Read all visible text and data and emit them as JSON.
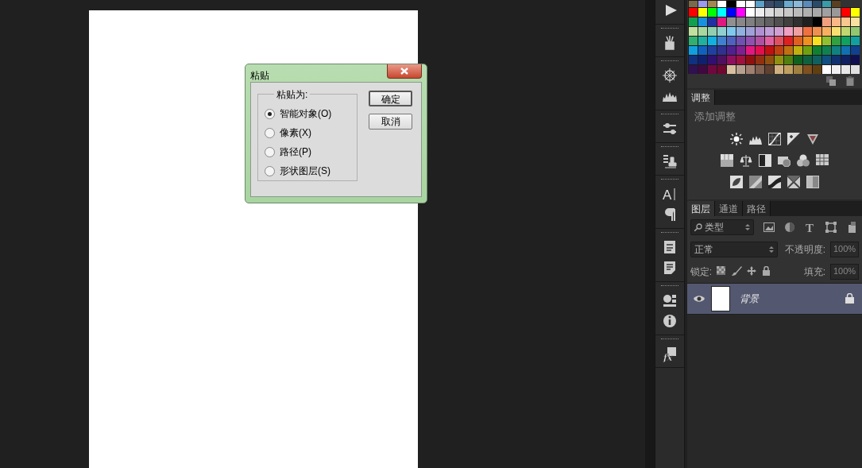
{
  "paste_dialog": {
    "title": "粘贴",
    "group_label": "粘贴为:",
    "options": [
      {
        "label": "智能对象(O)",
        "selected": true
      },
      {
        "label": "像素(X)",
        "selected": false
      },
      {
        "label": "路径(P)",
        "selected": false
      },
      {
        "label": "形状图层(S)",
        "selected": false
      }
    ],
    "buttons": [
      {
        "label": "确定",
        "default": true
      },
      {
        "label": "取消",
        "default": false
      }
    ]
  },
  "swatches": {
    "rows": [
      {
        "cells": [
          {
            "color": "#7a6a4a"
          },
          {
            "color": "#9a9aee"
          },
          {
            "color": "#a08850"
          },
          {
            "color": "#ffffff"
          },
          {
            "color": "#000000"
          },
          {
            "color": "#ffffff"
          },
          {
            "color": "#ffffff"
          },
          {
            "color": "#5aa0c8"
          },
          {
            "color": "#3a4a6a"
          },
          {
            "color": "#2a4a6a"
          },
          {
            "color": "#6aaad0"
          },
          {
            "color": "#8ab8d8"
          },
          {
            "color": "#5a8ab8"
          },
          {
            "color": "#2a4a6a"
          },
          {
            "color": "#3a9aa8"
          },
          {
            "color": "#5a4020"
          }
        ]
      },
      {
        "cells": [
          {
            "color": "#ff0000"
          },
          {
            "color": "#ffff00"
          },
          {
            "color": "#00ff00"
          },
          {
            "color": "#00ffff"
          },
          {
            "color": "#0000ff"
          },
          {
            "color": "#ff00ff"
          },
          {
            "color": "#ffffff"
          },
          {
            "color": "#eeeeee"
          },
          {
            "color": "#dddddd"
          },
          {
            "color": "#d0d0d0"
          },
          {
            "color": "#c8c8c8"
          },
          {
            "color": "#bbbbbb"
          },
          {
            "color": "#b0b0b0"
          },
          {
            "color": "#a8a8a8"
          },
          {
            "color": "#a0a0a0"
          },
          {
            "color": "#999999"
          },
          {
            "color": "#ff0000"
          },
          {
            "color": "#ffff00"
          }
        ]
      },
      {
        "cells": [
          {
            "color": "#10a050"
          },
          {
            "color": "#1890e0"
          },
          {
            "color": "#2030a0"
          },
          {
            "color": "#e01880"
          },
          {
            "color": "#909090"
          },
          {
            "color": "#888888"
          },
          {
            "color": "#808080"
          },
          {
            "color": "#707070"
          },
          {
            "color": "#606060"
          },
          {
            "color": "#505050"
          },
          {
            "color": "#404040"
          },
          {
            "color": "#303030"
          },
          {
            "color": "#202020"
          },
          {
            "color": "#000000"
          },
          {
            "color": "#f0a080"
          },
          {
            "color": "#f8b888"
          },
          {
            "color": "#f8c890"
          },
          {
            "color": "#f8e0a0"
          }
        ]
      },
      {
        "cells": [
          {
            "color": "#c0e0a0"
          },
          {
            "color": "#a8d8a0"
          },
          {
            "color": "#90d0b0"
          },
          {
            "color": "#90d0d0"
          },
          {
            "color": "#80c8f0"
          },
          {
            "color": "#90b0e0"
          },
          {
            "color": "#a0a0d8"
          },
          {
            "color": "#b090d0"
          },
          {
            "color": "#c0a0d8"
          },
          {
            "color": "#d0a0d0"
          },
          {
            "color": "#f0a0c0"
          },
          {
            "color": "#f0a0a0"
          },
          {
            "color": "#f07040"
          },
          {
            "color": "#f09050"
          },
          {
            "color": "#f8b060"
          },
          {
            "color": "#f8e070"
          },
          {
            "color": "#c0d870"
          },
          {
            "color": "#90c870"
          }
        ]
      },
      {
        "cells": [
          {
            "color": "#30b070"
          },
          {
            "color": "#20b0a0"
          },
          {
            "color": "#10b0e0"
          },
          {
            "color": "#4080d0"
          },
          {
            "color": "#5060c0"
          },
          {
            "color": "#7050b0"
          },
          {
            "color": "#9050b0"
          },
          {
            "color": "#b050a0"
          },
          {
            "color": "#e060a0"
          },
          {
            "color": "#e05060"
          },
          {
            "color": "#e02020"
          },
          {
            "color": "#e06020"
          },
          {
            "color": "#f09020"
          },
          {
            "color": "#f8e020"
          },
          {
            "color": "#90c030"
          },
          {
            "color": "#30a040"
          },
          {
            "color": "#10a060"
          },
          {
            "color": "#10a0a0"
          }
        ]
      },
      {
        "cells": [
          {
            "color": "#10a0e0"
          },
          {
            "color": "#1060c0"
          },
          {
            "color": "#2040a0"
          },
          {
            "color": "#303090"
          },
          {
            "color": "#502090"
          },
          {
            "color": "#802090"
          },
          {
            "color": "#e01880"
          },
          {
            "color": "#e01050"
          },
          {
            "color": "#c01010"
          },
          {
            "color": "#c04010"
          },
          {
            "color": "#c07010"
          },
          {
            "color": "#c0b010"
          },
          {
            "color": "#70a010"
          },
          {
            "color": "#108030"
          },
          {
            "color": "#108050"
          },
          {
            "color": "#108080"
          },
          {
            "color": "#1070b0"
          },
          {
            "color": "#104090"
          }
        ]
      },
      {
        "cells": [
          {
            "color": "#103080"
          },
          {
            "color": "#102070"
          },
          {
            "color": "#301070"
          },
          {
            "color": "#501060"
          },
          {
            "color": "#901060"
          },
          {
            "color": "#a01040"
          },
          {
            "color": "#901010"
          },
          {
            "color": "#903010"
          },
          {
            "color": "#905010"
          },
          {
            "color": "#909010"
          },
          {
            "color": "#508010"
          },
          {
            "color": "#106020"
          },
          {
            "color": "#106040"
          },
          {
            "color": "#106060"
          },
          {
            "color": "#105080"
          },
          {
            "color": "#103070"
          },
          {
            "color": "#102060"
          },
          {
            "color": "#101050"
          }
        ]
      },
      {
        "cells": [
          {
            "color": "#301050"
          },
          {
            "color": "#400840"
          },
          {
            "color": "#700840"
          },
          {
            "color": "#700830"
          },
          {
            "color": "#d8c0a0"
          },
          {
            "color": "#b8a090"
          },
          {
            "color": "#a08070"
          },
          {
            "color": "#806050"
          },
          {
            "color": "#604030"
          },
          {
            "color": "#d0b080"
          },
          {
            "color": "#c0a060"
          },
          {
            "color": "#a08040"
          },
          {
            "color": "#805020"
          },
          {
            "color": "#604010"
          },
          {
            "color": "#ffffff"
          },
          {
            "color": "#f0f0f0"
          },
          {
            "color": "#e8e8e8"
          },
          {
            "color": "#e0e0e0"
          }
        ]
      }
    ]
  },
  "toolbar": {
    "character_glyph": "A",
    "styles_glyph": "fx"
  },
  "adjustments": {
    "tabs": [
      {
        "label": "调整",
        "selected": true
      }
    ],
    "heading": "添加调整"
  },
  "layers": {
    "tabs": [
      {
        "label": "图层",
        "selected": true
      },
      {
        "label": "通道",
        "selected": false
      },
      {
        "label": "路径",
        "selected": false
      }
    ],
    "filter": "类型",
    "type_filter_glyph": "T",
    "blend_mode": "正常",
    "opacity_label": "不透明度:",
    "opacity": "100%",
    "lock_label": "锁定:",
    "fill_label": "填充:",
    "fill": "100%",
    "items": [
      {
        "name": "背景",
        "visible": true,
        "locked": true,
        "selected": true
      }
    ]
  }
}
